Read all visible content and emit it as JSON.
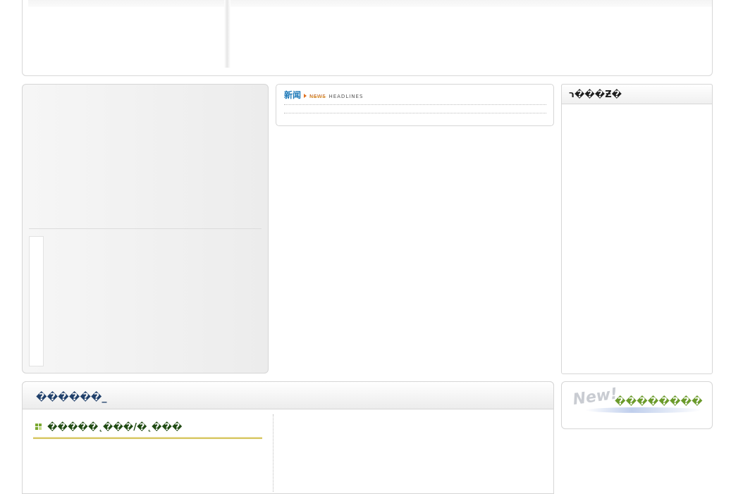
{
  "news": {
    "title_cn": "新闻",
    "title_en": "NEWS",
    "title_headlines": "HEADLINES"
  },
  "right_box": {
    "title": "ר���Ƶ�"
  },
  "bottom_box": {
    "title": "������_",
    "subsection_title": "�����˛���/�˛���"
  },
  "new_box": {
    "badge": "New!",
    "label": "��������"
  },
  "colors": {
    "news_blue": "#1c78b8",
    "news_orange": "#b44a00",
    "subsection_green": "#7aa830",
    "underline_gold": "#d8c868",
    "new_label_green": "#6a9a2a"
  }
}
